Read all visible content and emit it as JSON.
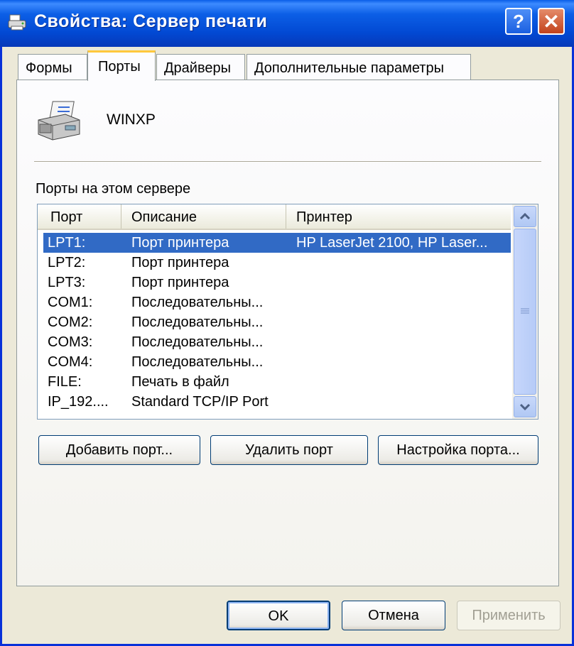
{
  "window": {
    "title": "Свойства: Сервер печати",
    "help_glyph": "?",
    "close_glyph": "✕"
  },
  "tabs": [
    {
      "label": "Формы",
      "active": false
    },
    {
      "label": "Порты",
      "active": true
    },
    {
      "label": "Драйверы",
      "active": false
    },
    {
      "label": "Дополнительные параметры",
      "active": false
    }
  ],
  "server": {
    "name": "WINXP"
  },
  "ports_label": "Порты на этом сервере",
  "columns": [
    "Порт",
    "Описание",
    "Принтер"
  ],
  "rows": [
    {
      "port": "LPT1:",
      "description": "Порт принтера",
      "printer": "HP LaserJet 2100, HP Laser..."
    },
    {
      "port": "LPT2:",
      "description": "Порт принтера",
      "printer": ""
    },
    {
      "port": "LPT3:",
      "description": "Порт принтера",
      "printer": ""
    },
    {
      "port": "COM1:",
      "description": "Последовательны...",
      "printer": ""
    },
    {
      "port": "COM2:",
      "description": "Последовательны...",
      "printer": ""
    },
    {
      "port": "COM3:",
      "description": "Последовательны...",
      "printer": ""
    },
    {
      "port": "COM4:",
      "description": "Последовательны...",
      "printer": ""
    },
    {
      "port": "FILE:",
      "description": "Печать в файл",
      "printer": ""
    },
    {
      "port": "IP_192....",
      "description": "Standard TCP/IP Port",
      "printer": ""
    }
  ],
  "port_buttons": {
    "add": "Добавить порт...",
    "delete": "Удалить порт",
    "configure": "Настройка порта..."
  },
  "dialog_buttons": {
    "ok": "OK",
    "cancel": "Отмена",
    "apply": "Применить"
  },
  "colors": {
    "titlebar": "#0249d3",
    "selection": "#316ac5",
    "dialog_bg": "#ece9d8",
    "active_tab_accent": "#ffc83c"
  }
}
